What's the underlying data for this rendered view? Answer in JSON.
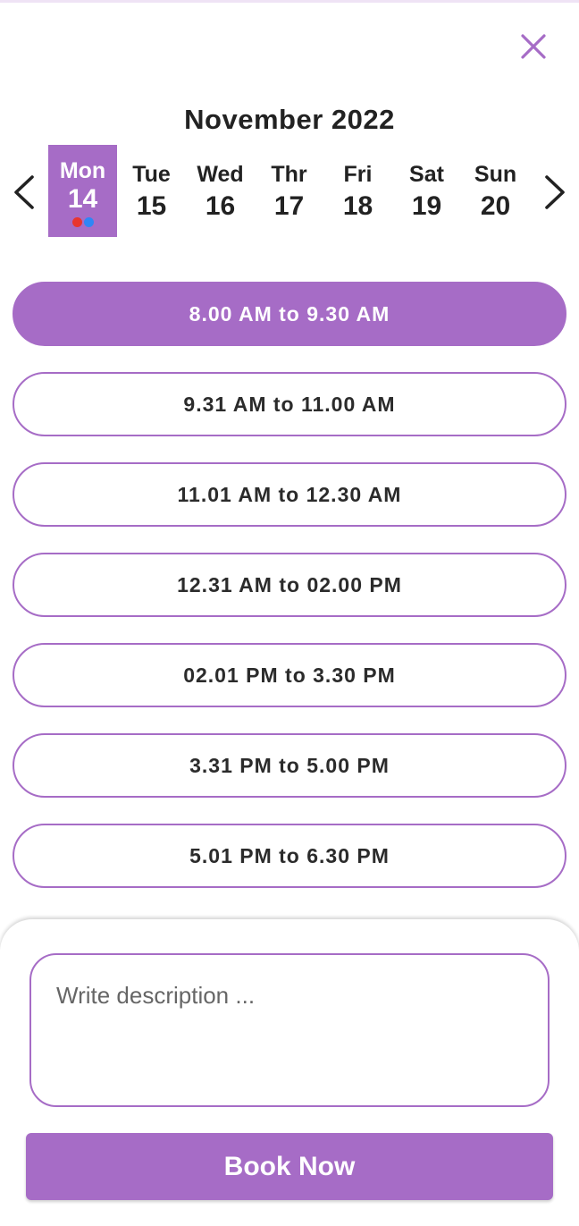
{
  "colors": {
    "accent": "#a66cc6",
    "text": "#222222",
    "dot_red": "#e8352f",
    "dot_blue": "#2f86f5"
  },
  "icons": {
    "close": "close-icon",
    "prev": "chevron-left-icon",
    "next": "chevron-right-icon"
  },
  "calendar": {
    "month_title": "November 2022",
    "days": [
      {
        "name": "Mon",
        "number": "14",
        "selected": true
      },
      {
        "name": "Tue",
        "number": "15",
        "selected": false
      },
      {
        "name": "Wed",
        "number": "16",
        "selected": false
      },
      {
        "name": "Thr",
        "number": "17",
        "selected": false
      },
      {
        "name": "Fri",
        "number": "18",
        "selected": false
      },
      {
        "name": "Sat",
        "number": "19",
        "selected": false
      },
      {
        "name": "Sun",
        "number": "20",
        "selected": false
      }
    ]
  },
  "slots": [
    {
      "label": "8.00 AM to 9.30 AM",
      "selected": true
    },
    {
      "label": "9.31 AM to 11.00 AM",
      "selected": false
    },
    {
      "label": "11.01 AM to 12.30 AM",
      "selected": false
    },
    {
      "label": "12.31 AM to 02.00 PM",
      "selected": false
    },
    {
      "label": "02.01 PM to 3.30 PM",
      "selected": false
    },
    {
      "label": "3.31 PM to 5.00 PM",
      "selected": false
    },
    {
      "label": "5.01 PM to 6.30 PM",
      "selected": false
    }
  ],
  "form": {
    "description_placeholder": "Write description ...",
    "description_value": "",
    "book_label": "Book Now"
  }
}
